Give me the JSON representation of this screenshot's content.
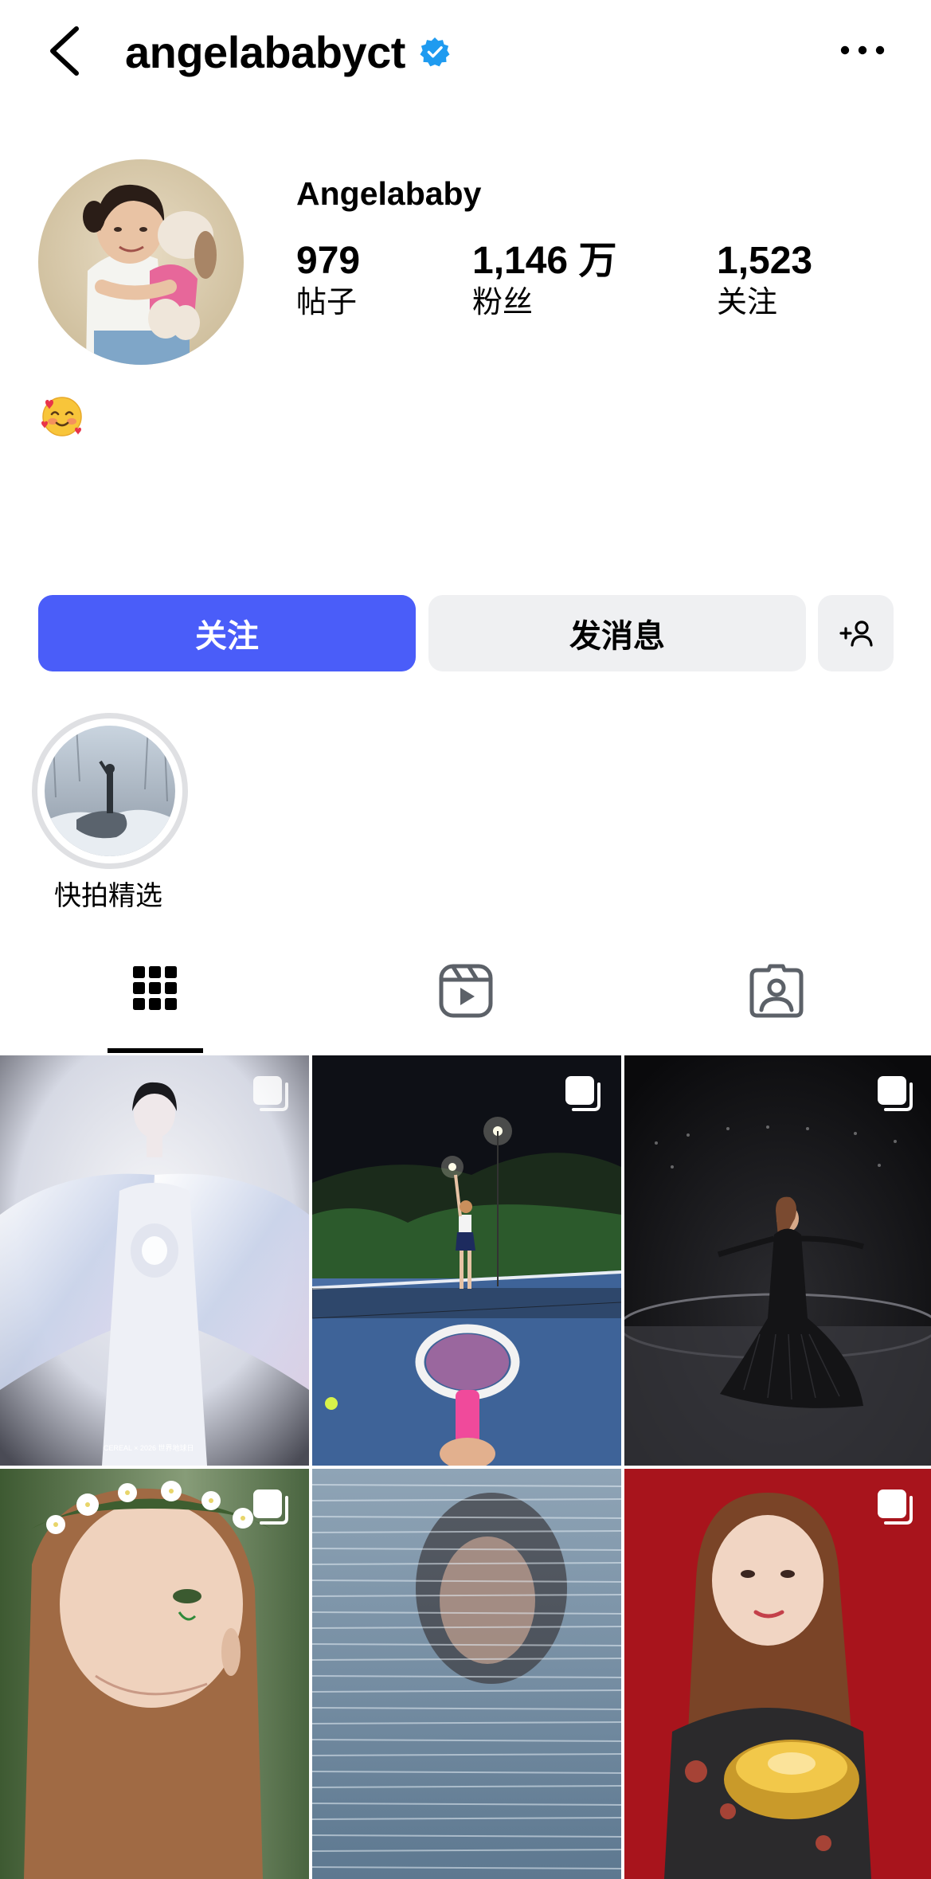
{
  "header": {
    "username": "angelababyct",
    "verified_icon": "verified-badge-icon",
    "back_icon": "chevron-left-icon",
    "more_icon": "more-horizontal-icon"
  },
  "profile": {
    "display_name": "Angelababy",
    "bio_emoji": "🥰",
    "stats": [
      {
        "value": "979",
        "label": "帖子"
      },
      {
        "value": "1,146 万",
        "label": "粉丝"
      },
      {
        "value": "1,523",
        "label": "关注"
      }
    ]
  },
  "actions": {
    "follow_label": "关注",
    "message_label": "发消息",
    "suggest_icon": "add-person-icon"
  },
  "highlights": [
    {
      "label": "快拍精选"
    }
  ],
  "tabs": [
    {
      "name": "posts",
      "icon": "grid-icon",
      "active": true
    },
    {
      "name": "reels",
      "icon": "reels-icon",
      "active": false
    },
    {
      "name": "tagged",
      "icon": "tagged-person-icon",
      "active": false
    }
  ],
  "posts": [
    {
      "caption": "CEREAL × 2026 世界地球日",
      "multi": true
    },
    {
      "caption": "",
      "multi": true
    },
    {
      "caption": "",
      "multi": true
    },
    {
      "caption": "",
      "multi": true
    },
    {
      "caption": "",
      "multi": false
    },
    {
      "caption": "",
      "multi": true
    }
  ],
  "colors": {
    "accent": "#4a5df9",
    "verified": "#1f9bf0",
    "button_secondary": "#eff0f2",
    "icon_gray": "#5c6168"
  }
}
